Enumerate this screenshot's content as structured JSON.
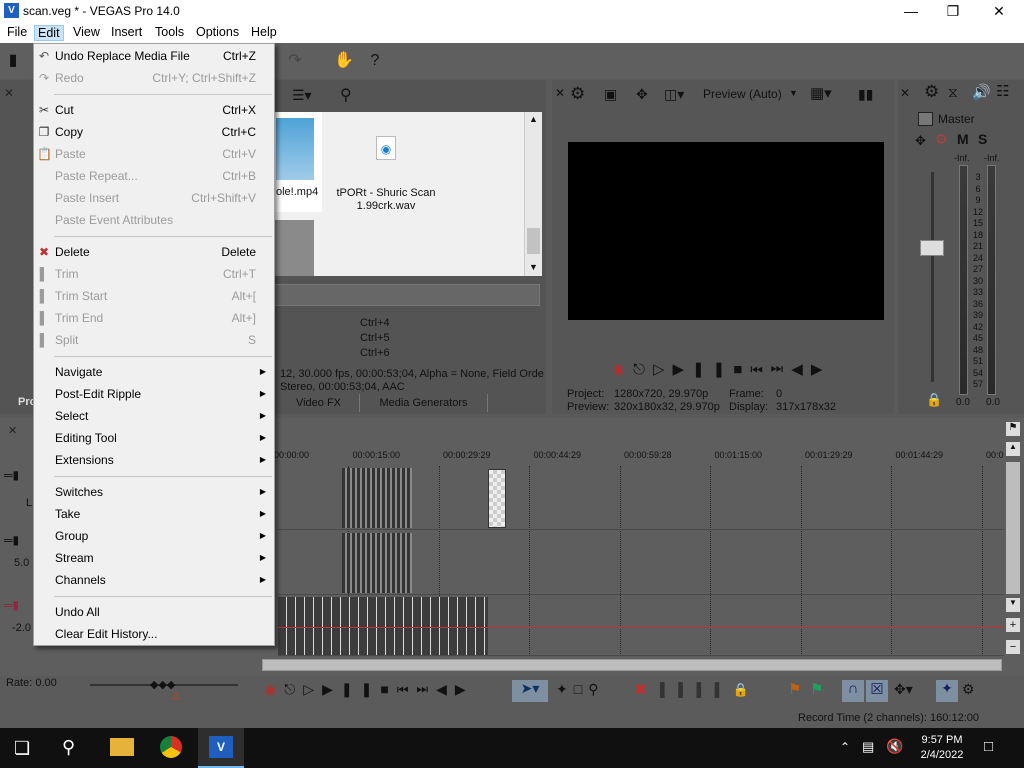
{
  "window": {
    "title": "scan.veg * - VEGAS Pro 14.0",
    "icon": "vegas-app-icon"
  },
  "menubar": {
    "items": [
      "File",
      "Edit",
      "View",
      "Insert",
      "Tools",
      "Options",
      "Help"
    ],
    "active": "Edit"
  },
  "edit_menu": {
    "items": [
      {
        "label": "Undo Replace Media File",
        "shortcut": "Ctrl+Z",
        "enabled": true,
        "icon": "undo-icon"
      },
      {
        "label": "Redo",
        "shortcut": "Ctrl+Y; Ctrl+Shift+Z",
        "enabled": false,
        "icon": "redo-icon"
      },
      {
        "label": "Cut",
        "shortcut": "Ctrl+X",
        "enabled": true,
        "icon": "scissors-icon"
      },
      {
        "label": "Copy",
        "shortcut": "Ctrl+C",
        "enabled": true,
        "icon": "copy-icon"
      },
      {
        "label": "Paste",
        "shortcut": "Ctrl+V",
        "enabled": false,
        "icon": "paste-icon"
      },
      {
        "label": "Paste Repeat...",
        "shortcut": "Ctrl+B",
        "enabled": false
      },
      {
        "label": "Paste Insert",
        "shortcut": "Ctrl+Shift+V",
        "enabled": false
      },
      {
        "label": "Paste Event Attributes",
        "shortcut": "",
        "enabled": false
      },
      {
        "label": "Delete",
        "shortcut": "Delete",
        "enabled": true,
        "icon": "delete-icon"
      },
      {
        "label": "Trim",
        "shortcut": "Ctrl+T",
        "enabled": false,
        "icon": "trim-icon"
      },
      {
        "label": "Trim Start",
        "shortcut": "Alt+[",
        "enabled": false,
        "icon": "trim-start-icon"
      },
      {
        "label": "Trim End",
        "shortcut": "Alt+]",
        "enabled": false,
        "icon": "trim-end-icon"
      },
      {
        "label": "Split",
        "shortcut": "S",
        "enabled": false,
        "icon": "split-icon"
      },
      {
        "label": "Navigate",
        "submenu": true,
        "enabled": true
      },
      {
        "label": "Post-Edit Ripple",
        "submenu": true,
        "enabled": true
      },
      {
        "label": "Select",
        "submenu": true,
        "enabled": true
      },
      {
        "label": "Editing Tool",
        "submenu": true,
        "enabled": true
      },
      {
        "label": "Extensions",
        "submenu": true,
        "enabled": true
      },
      {
        "label": "Switches",
        "submenu": true,
        "enabled": true
      },
      {
        "label": "Take",
        "submenu": true,
        "enabled": true
      },
      {
        "label": "Group",
        "submenu": true,
        "enabled": true
      },
      {
        "label": "Stream",
        "submenu": true,
        "enabled": true
      },
      {
        "label": "Channels",
        "submenu": true,
        "enabled": true
      },
      {
        "label": "Undo All",
        "shortcut": "",
        "enabled": true
      },
      {
        "label": "Clear Edit History...",
        "shortcut": "",
        "enabled": true
      }
    ]
  },
  "explorer": {
    "files": [
      {
        "name": "ole!.mp4"
      },
      {
        "name": "tPORt - Shuric Scan 1.99crk.wav"
      }
    ],
    "shortcuts": [
      "Ctrl+4",
      "Ctrl+5",
      "Ctrl+6"
    ],
    "media_info_line1": "12, 30.000 fps, 00:00:53;04, Alpha = None, Field Orde",
    "media_info_line2": "Stereo, 00:00:53;04, AAC",
    "tabs": [
      "Video FX",
      "Media Generators"
    ],
    "side_label": "Pro"
  },
  "preview": {
    "mode": "Preview (Auto)",
    "project_label": "Project:",
    "project_value": "1280x720, 29.970p",
    "frame_label": "Frame:",
    "frame_value": "0",
    "preview_label": "Preview:",
    "preview_value": "320x180x32, 29.970p",
    "display_label": "Display:",
    "display_value": "317x178x32"
  },
  "mixer": {
    "title": "Master",
    "mute": "M",
    "solo": "S",
    "inf_left": "-Inf.",
    "inf_right": "-Inf.",
    "scale": [
      "3",
      "6",
      "9",
      "12",
      "15",
      "18",
      "21",
      "24",
      "27",
      "30",
      "33",
      "36",
      "39",
      "42",
      "45",
      "48",
      "51",
      "54",
      "57"
    ],
    "value_left": "0.0",
    "value_right": "0.0"
  },
  "timeline": {
    "ticks": [
      "00:00:00",
      "00:00:15:00",
      "00:00:29:29",
      "00:00:44:29",
      "00:00:59:28",
      "00:01:15:00",
      "00:01:29:29",
      "00:01:44:29",
      "00:0"
    ],
    "track_labels": [
      "L",
      "5.0",
      "-2.0"
    ]
  },
  "rate": "Rate: 0.00",
  "status": {
    "record_time": "Record Time (2 channels): 160:12:00"
  },
  "taskbar": {
    "time": "9:57 PM",
    "date": "2/4/2022"
  },
  "colors": {
    "menu_bg": "#f0f0f0",
    "menu_highlight": "#cce4f7",
    "app_bg": "#5a5a5a",
    "taskbar": "#101010"
  }
}
